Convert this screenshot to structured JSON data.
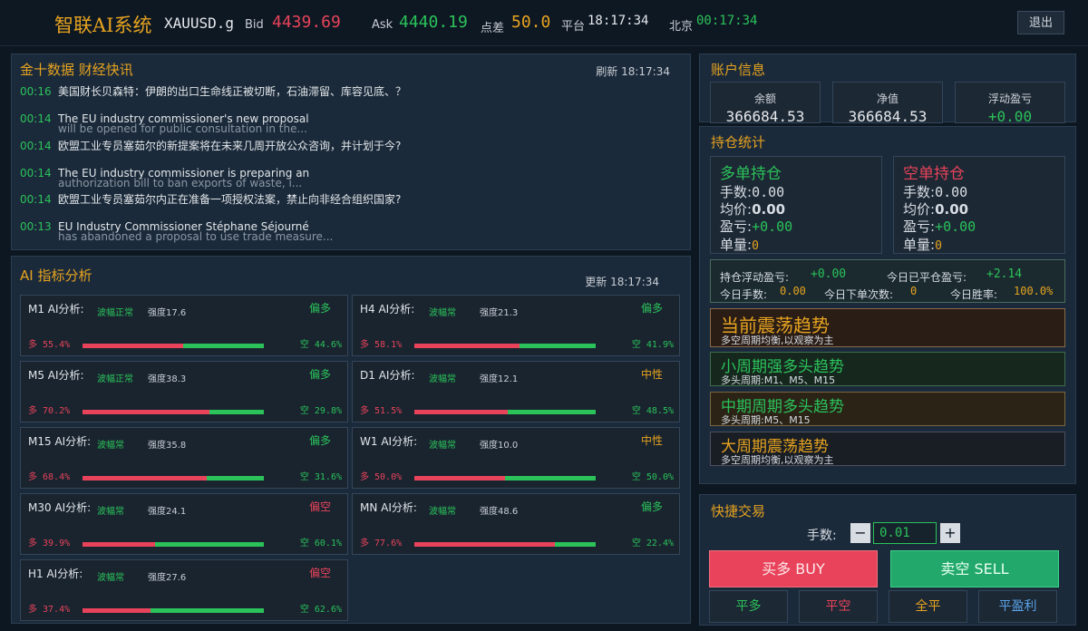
{
  "header": {
    "app_title": "智联AI系统",
    "symbol": "XAUUSD.g",
    "bid_label": "Bid",
    "bid_value": "4439.69",
    "ask_label": "Ask",
    "ask_value": "4440.19",
    "spread_label": "点差",
    "spread_value": "50.0",
    "platform_label": "平台",
    "platform_time": "18:17:34",
    "beijing_label": "北京",
    "beijing_time": "00:17:34",
    "logout_label": "退出"
  },
  "news": {
    "title": "金十数据 财经快讯",
    "refresh_label": "刷新 18:17:34",
    "items": [
      {
        "time": "00:16",
        "title": "美国财长贝森特：伊朗的出口生命线正被切断，石油滞留、库容见底、？",
        "sub": ""
      },
      {
        "time": "00:14",
        "title": "The EU industry commissioner's new proposal",
        "sub": "will be opened for public consultation in the..."
      },
      {
        "time": "00:14",
        "title": "欧盟工业专员塞茹尔的新提案将在未来几周开放公众咨询，并计划于今?",
        "sub": ""
      },
      {
        "time": "00:14",
        "title": "The EU industry commissioner is preparing an",
        "sub": "authorization bill to ban exports of waste, i..."
      },
      {
        "time": "00:14",
        "title": "欧盟工业专员塞茹尔内正在准备一项授权法案，禁止向非经合组织国家?",
        "sub": ""
      },
      {
        "time": "00:13",
        "title": "EU Industry Commissioner Stéphane Séjourné",
        "sub": "has abandoned a proposal to use trade measure..."
      }
    ]
  },
  "ai": {
    "title": "AI 指标分析",
    "update_label": "更新 18:17:34",
    "cards": [
      {
        "label": "M1 AI分析:",
        "status": "波幅正常",
        "strength": "强度17.6",
        "bias": "偏多",
        "bias_color": "#2bc25a",
        "long": "多 55.4%",
        "short": "空 44.6%",
        "long_pct": 55.4
      },
      {
        "label": "H4 AI分析:",
        "status": "波幅常",
        "strength": "强度21.3",
        "bias": "偏多",
        "bias_color": "#2bc25a",
        "long": "多 58.1%",
        "short": "空 41.9%",
        "long_pct": 58.1
      },
      {
        "label": "M5 AI分析:",
        "status": "波幅正常",
        "strength": "强度38.3",
        "bias": "偏多",
        "bias_color": "#2bc25a",
        "long": "多 70.2%",
        "short": "空 29.8%",
        "long_pct": 70.2
      },
      {
        "label": "D1 AI分析:",
        "status": "波幅常",
        "strength": "强度12.1",
        "bias": "中性",
        "bias_color": "#e6a320",
        "long": "多 51.5%",
        "short": "空 48.5%",
        "long_pct": 51.5
      },
      {
        "label": "M15 AI分析:",
        "status": "波幅常",
        "strength": "强度35.8",
        "bias": "偏多",
        "bias_color": "#2bc25a",
        "long": "多 68.4%",
        "short": "空 31.6%",
        "long_pct": 68.4
      },
      {
        "label": "W1 AI分析:",
        "status": "波幅常",
        "strength": "强度10.0",
        "bias": "中性",
        "bias_color": "#e6a320",
        "long": "多 50.0%",
        "short": "空 50.0%",
        "long_pct": 50.0
      },
      {
        "label": "M30 AI分析:",
        "status": "波幅常",
        "strength": "强度24.1",
        "bias": "偏空",
        "bias_color": "#e8435a",
        "long": "多 39.9%",
        "short": "空 60.1%",
        "long_pct": 39.9
      },
      {
        "label": "MN AI分析:",
        "status": "波幅常",
        "strength": "强度48.6",
        "bias": "偏多",
        "bias_color": "#2bc25a",
        "long": "多 77.6%",
        "short": "空 22.4%",
        "long_pct": 77.6
      },
      {
        "label": "H1 AI分析:",
        "status": "波幅常",
        "strength": "强度27.6",
        "bias": "偏空",
        "bias_color": "#e8435a",
        "long": "多 37.4%",
        "short": "空 62.6%",
        "long_pct": 37.4
      }
    ]
  },
  "account": {
    "title": "账户信息",
    "balance_label": "余额",
    "balance_value": "366684.53",
    "equity_label": "净值",
    "equity_value": "366684.53",
    "float_label": "浮动盈亏",
    "float_value": "+0.00"
  },
  "positions": {
    "title": "持仓统计",
    "long_title": "多单持仓",
    "short_title": "空单持仓",
    "lots_label": "手数:",
    "avg_label": "均价:",
    "pnl_label": "盈亏:",
    "count_label": "单量:",
    "long_lots": "0.00",
    "long_avg": "0.00",
    "long_pnl": "+0.00",
    "long_count": "0",
    "short_lots": "0.00",
    "short_avg": "0.00",
    "short_pnl": "+0.00",
    "short_count": "0",
    "float_pnl_label": "持仓浮动盈亏:",
    "float_pnl_value": "+0.00",
    "closed_today_label": "今日已平仓盈亏:",
    "closed_today_value": "+2.14",
    "today_lots_label": "今日手数:",
    "today_lots_value": "0.00",
    "today_orders_label": "今日下单次数:",
    "today_orders_value": "0",
    "win_rate_label": "今日胜率:",
    "win_rate_value": "100.0%"
  },
  "trends": [
    {
      "title": "当前震荡趋势",
      "sub": "多空周期均衡,以观察为主",
      "title_color": "#e6a320",
      "bg": "#2a1d16",
      "border": "#8a6a48"
    },
    {
      "title": "小周期强多头趋势",
      "sub": "多头周期:M1、M5、M15",
      "title_color": "#2bc25a",
      "bg": "#16281e",
      "border": "#3e6b4c"
    },
    {
      "title": "中期周期多头趋势",
      "sub": "多头周期:M5、M15",
      "title_color": "#2bc25a",
      "bg": "#2a2316",
      "border": "#7a6640"
    },
    {
      "title": "大周期震荡趋势",
      "sub": "多空周期均衡,以观察为主",
      "title_color": "#e6a320",
      "bg": "#191d24",
      "border": "#4a5060"
    }
  ],
  "quick_trade": {
    "title": "快捷交易",
    "lots_label": "手数:",
    "minus_label": "−",
    "lots_value": "0.01",
    "plus_label": "+",
    "buy_label": "买多 BUY",
    "sell_label": "卖空 SELL",
    "close_long_label": "平多",
    "close_short_label": "平空",
    "close_all_label": "全平",
    "close_profit_label": "平盈利"
  },
  "colors": {
    "bid": "#e8435a",
    "ask": "#2bc25a",
    "accent": "#e6a320",
    "buy": "#e8435a",
    "sell": "#21a86a"
  }
}
